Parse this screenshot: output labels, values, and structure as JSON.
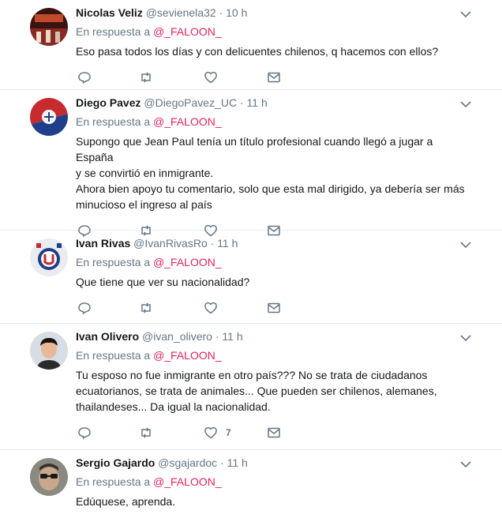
{
  "colors": {
    "link": "#e0245e",
    "muted": "#657786",
    "text": "#14171a",
    "divider": "#e6ecf0"
  },
  "icons": {
    "reply": "reply-icon",
    "retweet": "retweet-icon",
    "like": "heart-icon",
    "dm": "envelope-icon",
    "menu": "chevron-down-icon"
  },
  "tweets": [
    {
      "name": "Nicolas Veliz",
      "handle": "@sevienela32",
      "dot": "·",
      "time": "10 h",
      "reply_prefix": "En respuesta a",
      "reply_to": "@_FALOON_",
      "lines": [
        "Eso pasa todos los días y con delicuentes chilenos, q hacemos con ellos?"
      ],
      "likes": ""
    },
    {
      "name": "Diego Pavez",
      "handle": "@DiegoPavez_UC",
      "dot": "·",
      "time": "11 h",
      "reply_prefix": "En respuesta a",
      "reply_to": "@_FALOON_",
      "lines": [
        "Supongo que Jean Paul tenía un título profesional cuando llegó a jugar a España",
        "y se convirtió en inmigrante.",
        "Ahora bien apoyo tu comentario, solo que esta mal dirigido, ya debería ser más",
        "minucioso el ingreso al país"
      ],
      "likes": ""
    },
    {
      "name": "Ivan Rivas",
      "handle": "@IvanRivasRo",
      "dot": "·",
      "time": "11 h",
      "reply_prefix": "En respuesta a",
      "reply_to": "@_FALOON_",
      "lines": [
        "Que tiene que ver su nacionalidad?"
      ],
      "likes": ""
    },
    {
      "name": "Ivan Olivero",
      "handle": "@ivan_olivero",
      "dot": "·",
      "time": "11 h",
      "reply_prefix": "En respuesta a",
      "reply_to": "@_FALOON_",
      "lines": [
        "Tu esposo no fue inmigrante en otro país???  No se trata de ciudadanos",
        "ecuatorianos,  se trata de animales... Que pueden ser chilenos,  alemanes,",
        "thailandeses...  Da igual la nacionalidad."
      ],
      "likes": "7"
    },
    {
      "name": "Sergio Gajardo",
      "handle": "@sgajardoc",
      "dot": "·",
      "time": "11 h",
      "reply_prefix": "En respuesta a",
      "reply_to": "@_FALOON_",
      "lines": [
        "Edúquese, aprenda."
      ],
      "likes": ""
    }
  ]
}
